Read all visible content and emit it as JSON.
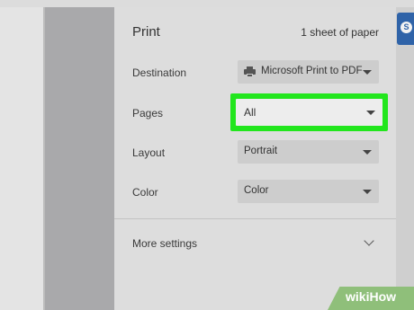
{
  "print_panel": {
    "title": "Print",
    "sheets": "1 sheet of paper",
    "destination": {
      "label": "Destination",
      "value": "Microsoft Print to PDF",
      "icon": "printer-icon"
    },
    "pages": {
      "label": "Pages",
      "value": "All"
    },
    "layout": {
      "label": "Layout",
      "value": "Portrait"
    },
    "color": {
      "label": "Color",
      "value": "Color"
    },
    "more_settings": "More settings"
  },
  "side_tab": {
    "letter": "S"
  },
  "watermark": {
    "prefix": "wiki",
    "suffix": "How"
  },
  "colors": {
    "highlight": "#22e61d",
    "tab_blue": "#2f63a8"
  }
}
